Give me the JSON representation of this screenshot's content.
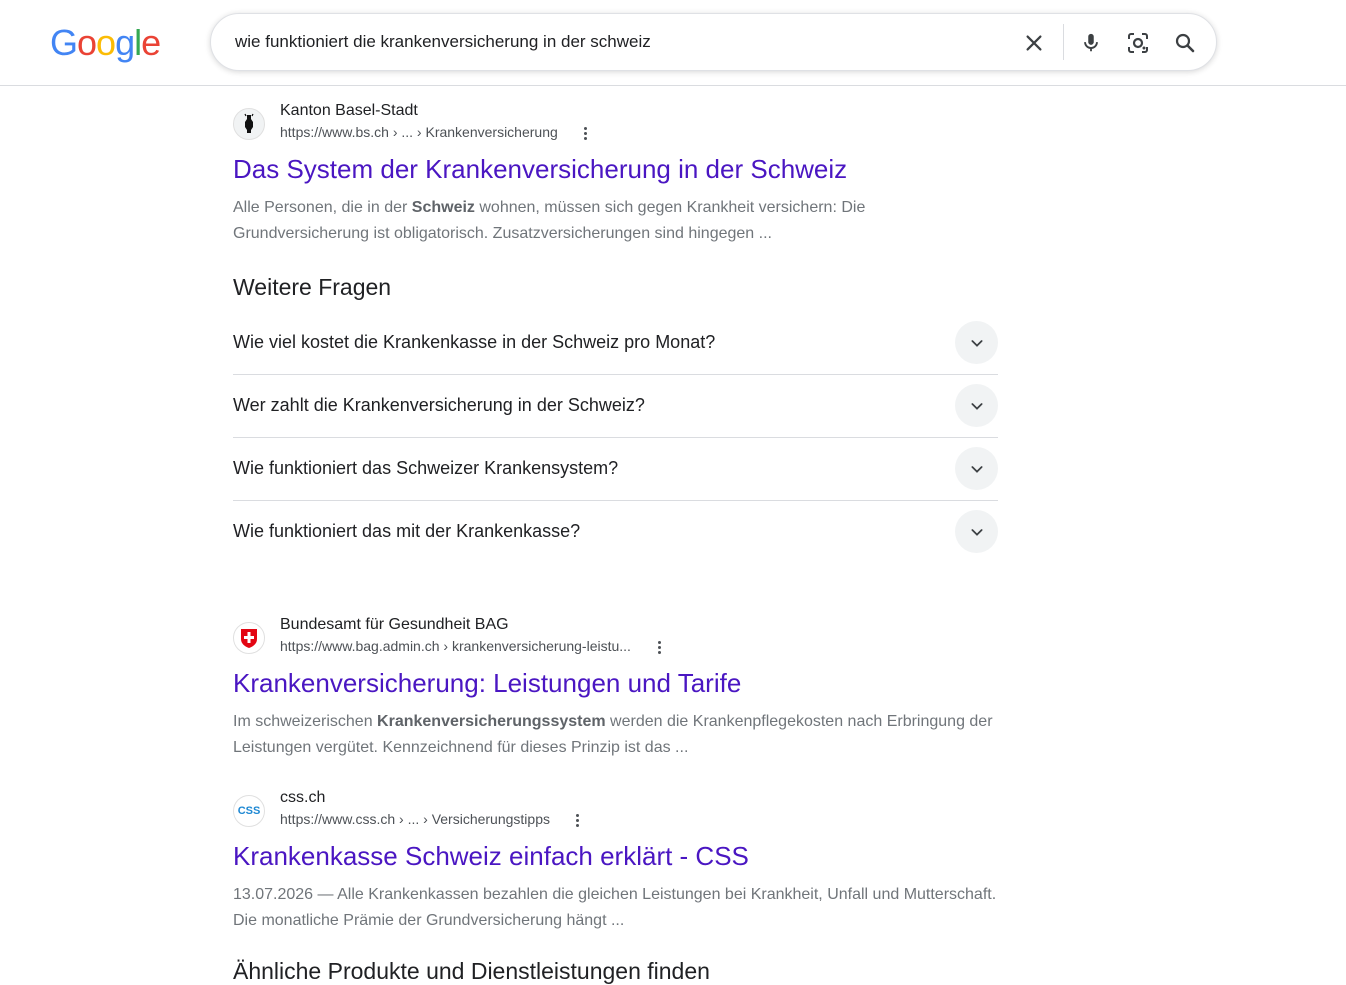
{
  "header": {
    "logo": "Google",
    "search": {
      "value": "wie funktioniert die krankenversicherung in der schweiz"
    },
    "icons": [
      "close-icon",
      "mic-icon",
      "lens-icon",
      "search-icon"
    ]
  },
  "results": [
    {
      "site_name": "Kanton Basel-Stadt",
      "url": "https://www.bs.ch › ... › Krankenversicherung",
      "title": "Das System der Krankenversicherung in der Schweiz",
      "snippet_pre": "Alle Personen, die in der ",
      "snippet_bold": "Schweiz",
      "snippet_post": " wohnen, müssen sich gegen Krankheit versichern: Die Grundversicherung ist obligatorisch. Zusatzversicherungen sind hingegen ..."
    },
    {
      "site_name": "Bundesamt für Gesundheit BAG",
      "url": "https://www.bag.admin.ch › krankenversicherung-leistu...",
      "title": "Krankenversicherung: Leistungen und Tarife",
      "snippet_pre": "Im schweizerischen ",
      "snippet_bold": "Krankenversicherungssystem",
      "snippet_post": " werden die Krankenpflegekosten nach Erbringung der Leistungen vergütet. Kennzeichnend für dieses Prinzip ist das ..."
    },
    {
      "site_name": "css.ch",
      "url": "https://www.css.ch › ... › Versicherungstipps",
      "title": "Krankenkasse Schweiz einfach erklärt - CSS",
      "snippet_pre": "13.07.2026 — Alle Krankenkassen bezahlen die gleichen Leistungen bei Krankheit, Unfall und Mutterschaft. Die monatliche Prämie der Grundversicherung hängt ...",
      "snippet_bold": "",
      "snippet_post": "",
      "favicon_text": "CSS"
    }
  ],
  "paa": {
    "heading": "Weitere Fragen",
    "questions": [
      "Wie viel kostet die Krankenkasse in der Schweiz pro Monat?",
      "Wer zahlt die Krankenversicherung in der Schweiz?",
      "Wie funktioniert das Schweizer Krankensystem?",
      "Wie funktioniert das mit der Krankenkasse?"
    ]
  },
  "next_section_heading": "Ähnliche Produkte und Dienstleistungen finden"
}
